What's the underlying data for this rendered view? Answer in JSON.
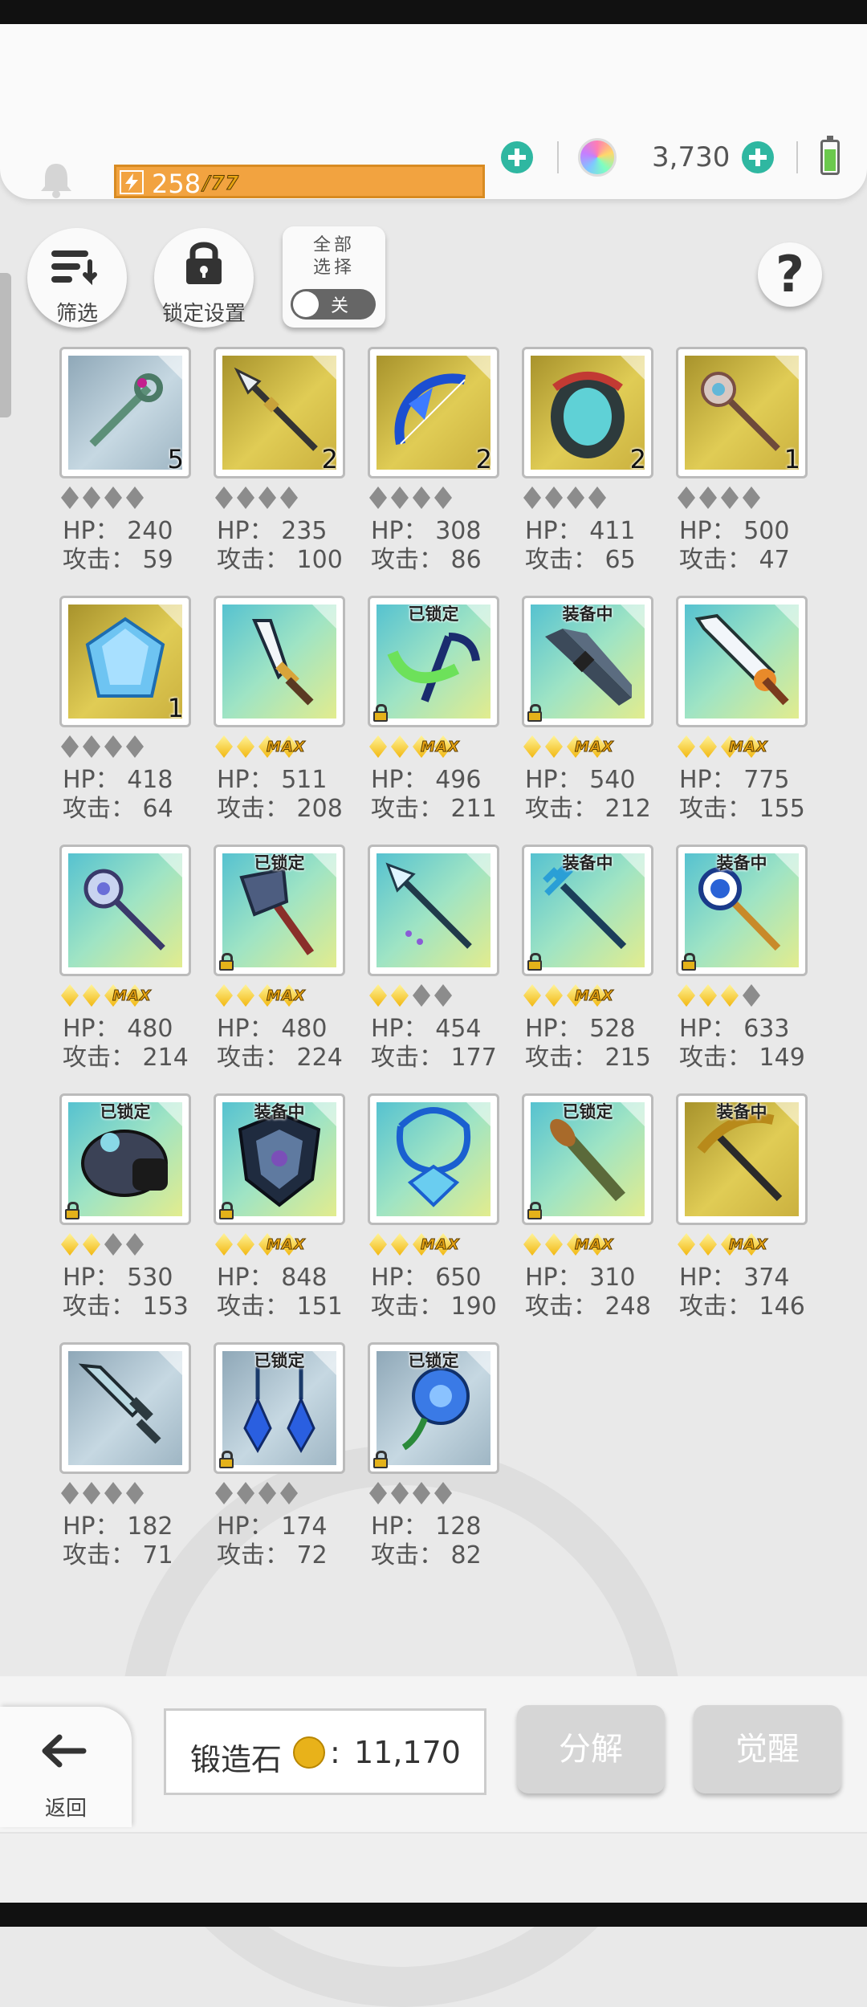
{
  "header": {
    "energy": {
      "current": "258",
      "max": "/77",
      "fill": 1.0
    },
    "gems": "3,730",
    "icons": {
      "bell": "bell-icon",
      "energy": "lightning-icon",
      "gem": "rainbow-gem-icon",
      "battery": "battery-icon"
    },
    "accent": "#2fb7a1",
    "energy_color": "#f2a340"
  },
  "toolbar": {
    "filter_label": "筛选",
    "lock_settings_label": "锁定设置",
    "select_all_label": "全部\n选择",
    "toggle_state": "关"
  },
  "items": [
    {
      "hp_label": "HP：",
      "hp": "240",
      "atk_label": "攻击：",
      "atk": "59",
      "bg": "blue",
      "icon": "staff-icon",
      "count": "5",
      "tag": "",
      "locked": false,
      "stars": 0,
      "max": false
    },
    {
      "hp_label": "HP：",
      "hp": "235",
      "atk_label": "攻击：",
      "atk": "100",
      "bg": "gold",
      "icon": "spear-icon",
      "count": "2",
      "tag": "",
      "locked": false,
      "stars": 0,
      "max": false
    },
    {
      "hp_label": "HP：",
      "hp": "308",
      "atk_label": "攻击：",
      "atk": "86",
      "bg": "gold",
      "icon": "bow-icon",
      "count": "2",
      "tag": "",
      "locked": false,
      "stars": 0,
      "max": false
    },
    {
      "hp_label": "HP：",
      "hp": "411",
      "atk_label": "攻击：",
      "atk": "65",
      "bg": "gold",
      "icon": "armor-icon",
      "count": "2",
      "tag": "",
      "locked": false,
      "stars": 0,
      "max": false
    },
    {
      "hp_label": "HP：",
      "hp": "500",
      "atk_label": "攻击：",
      "atk": "47",
      "bg": "gold",
      "icon": "scepter-icon",
      "count": "1",
      "tag": "",
      "locked": false,
      "stars": 0,
      "max": false
    },
    {
      "hp_label": "HP：",
      "hp": "418",
      "atk_label": "攻击：",
      "atk": "64",
      "bg": "gold",
      "icon": "crystal-icon",
      "count": "1",
      "tag": "",
      "locked": false,
      "stars": 0,
      "max": false
    },
    {
      "hp_label": "HP：",
      "hp": "511",
      "atk_label": "攻击：",
      "atk": "208",
      "bg": "teal",
      "icon": "dagger-icon",
      "count": "",
      "tag": "",
      "locked": false,
      "stars": 2,
      "max": true
    },
    {
      "hp_label": "HP：",
      "hp": "496",
      "atk_label": "攻击：",
      "atk": "211",
      "bg": "teal",
      "icon": "scythe-icon",
      "count": "",
      "tag": "已锁定",
      "locked": true,
      "stars": 2,
      "max": true
    },
    {
      "hp_label": "HP：",
      "hp": "540",
      "atk_label": "攻击：",
      "atk": "212",
      "bg": "teal",
      "icon": "rifle-icon",
      "count": "",
      "tag": "装备中",
      "locked": true,
      "stars": 2,
      "max": true
    },
    {
      "hp_label": "HP：",
      "hp": "775",
      "atk_label": "攻击：",
      "atk": "155",
      "bg": "teal",
      "icon": "greatsword-icon",
      "count": "",
      "tag": "",
      "locked": false,
      "stars": 2,
      "max": true
    },
    {
      "hp_label": "HP：",
      "hp": "480",
      "atk_label": "攻击：",
      "atk": "214",
      "bg": "teal",
      "icon": "mace-icon",
      "count": "",
      "tag": "",
      "locked": false,
      "stars": 2,
      "max": true
    },
    {
      "hp_label": "HP：",
      "hp": "480",
      "atk_label": "攻击：",
      "atk": "224",
      "bg": "teal",
      "icon": "axe-icon",
      "count": "",
      "tag": "已锁定",
      "locked": true,
      "stars": 2,
      "max": true
    },
    {
      "hp_label": "HP：",
      "hp": "454",
      "atk_label": "攻击：",
      "atk": "177",
      "bg": "teal",
      "icon": "lance-icon",
      "count": "",
      "tag": "",
      "locked": false,
      "stars": 2,
      "max": false
    },
    {
      "hp_label": "HP：",
      "hp": "528",
      "atk_label": "攻击：",
      "atk": "215",
      "bg": "teal",
      "icon": "trident-icon",
      "count": "",
      "tag": "装备中",
      "locked": true,
      "stars": 2,
      "max": true
    },
    {
      "hp_label": "HP：",
      "hp": "633",
      "atk_label": "攻击：",
      "atk": "149",
      "bg": "teal",
      "icon": "orb-staff-icon",
      "count": "",
      "tag": "装备中",
      "locked": true,
      "stars": 3,
      "max": false
    },
    {
      "hp_label": "HP：",
      "hp": "530",
      "atk_label": "攻击：",
      "atk": "153",
      "bg": "teal",
      "icon": "gauntlet-icon",
      "count": "",
      "tag": "已锁定",
      "locked": true,
      "stars": 2,
      "max": false
    },
    {
      "hp_label": "HP：",
      "hp": "848",
      "atk_label": "攻击：",
      "atk": "151",
      "bg": "teal",
      "icon": "shield-icon",
      "count": "",
      "tag": "装备中",
      "locked": true,
      "stars": 2,
      "max": true
    },
    {
      "hp_label": "HP：",
      "hp": "650",
      "atk_label": "攻击：",
      "atk": "190",
      "bg": "teal",
      "icon": "necklace-icon",
      "count": "",
      "tag": "",
      "locked": false,
      "stars": 2,
      "max": true
    },
    {
      "hp_label": "HP：",
      "hp": "310",
      "atk_label": "攻击：",
      "atk": "248",
      "bg": "teal",
      "icon": "bazooka-icon",
      "count": "",
      "tag": "已锁定",
      "locked": true,
      "stars": 2,
      "max": true
    },
    {
      "hp_label": "HP：",
      "hp": "374",
      "atk_label": "攻击：",
      "atk": "146",
      "bg": "gold",
      "icon": "pickaxe-icon",
      "count": "",
      "tag": "装备中",
      "locked": false,
      "stars": 2,
      "max": true
    },
    {
      "hp_label": "HP：",
      "hp": "182",
      "atk_label": "攻击：",
      "atk": "71",
      "bg": "blue",
      "icon": "sword-icon",
      "count": "",
      "tag": "",
      "locked": false,
      "stars": 0,
      "max": false
    },
    {
      "hp_label": "HP：",
      "hp": "174",
      "atk_label": "攻击：",
      "atk": "72",
      "bg": "blue",
      "icon": "earrings-icon",
      "count": "",
      "tag": "已锁定",
      "locked": true,
      "stars": 0,
      "max": false
    },
    {
      "hp_label": "HP：",
      "hp": "128",
      "atk_label": "攻击：",
      "atk": "82",
      "bg": "blue",
      "icon": "flower-icon",
      "count": "",
      "tag": "已锁定",
      "locked": true,
      "stars": 0,
      "max": false
    }
  ],
  "max_label": "MAX",
  "footer": {
    "back_label": "返回",
    "stone_label": "锻造石",
    "stone_sep": ":",
    "stone_value": "11,170",
    "decompose_label": "分解",
    "awaken_label": "觉醒"
  }
}
